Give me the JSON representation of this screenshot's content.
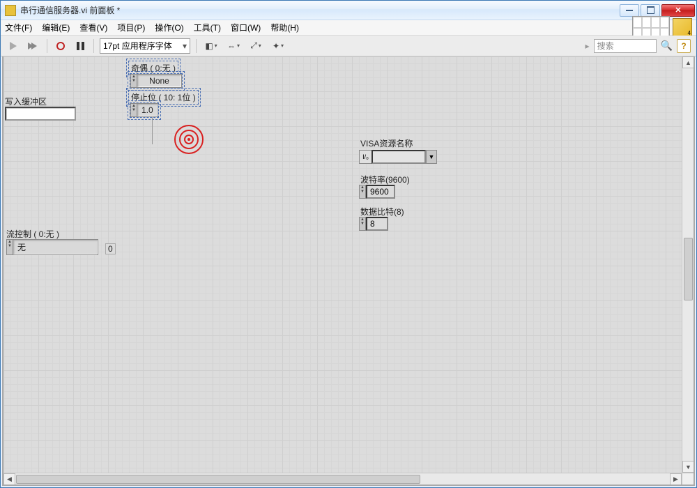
{
  "window": {
    "title": "串行通信服务器.vi 前面板 *"
  },
  "menu": {
    "items": [
      "文件(F)",
      "编辑(E)",
      "查看(V)",
      "项目(P)",
      "操作(O)",
      "工具(T)",
      "窗口(W)",
      "帮助(H)"
    ]
  },
  "toolbar": {
    "font_selector": "17pt 应用程序字体",
    "search_placeholder": "搜索"
  },
  "controls": {
    "write_buffer_label": "写入缓冲区",
    "parity_label": "奇偶 ( 0:无 )",
    "parity_value": "None",
    "stopbits_label": "停止位 ( 10: 1位 )",
    "stopbits_value": "1.0",
    "flowcontrol_label": "流控制 ( 0:无 )",
    "flowcontrol_value": "无",
    "flowcontrol_extra": "0",
    "visa_label": "VISA资源名称",
    "visa_value": "",
    "baud_label": "波特率(9600)",
    "baud_value": "9600",
    "databits_label": "数据比特(8)",
    "databits_value": "8"
  }
}
